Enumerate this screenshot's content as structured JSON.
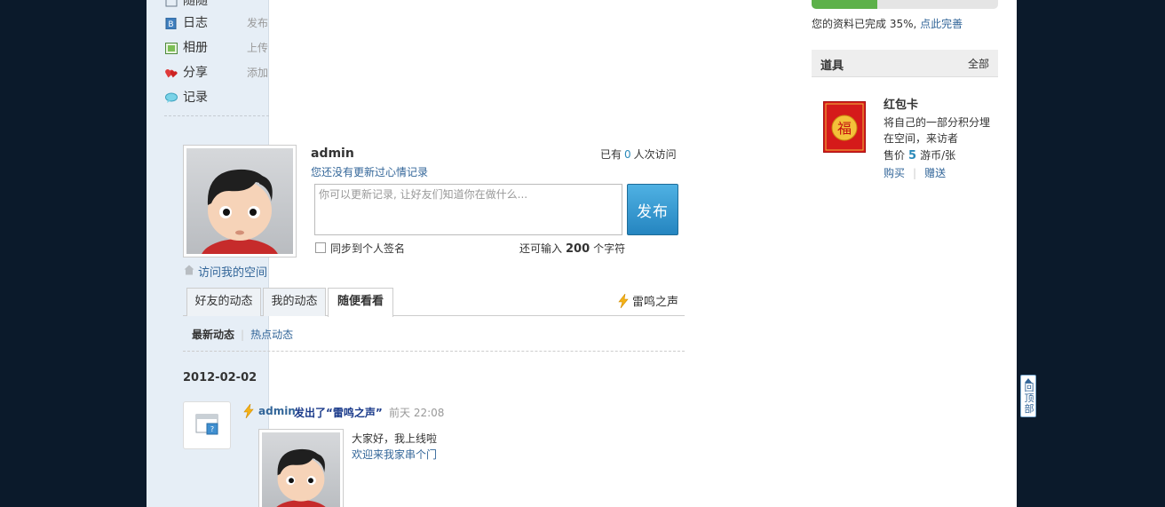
{
  "sidebar": {
    "items": [
      {
        "label": "随随",
        "action": "",
        "icon": "partial-icon"
      },
      {
        "label": "日志",
        "action": "发布",
        "icon": "blog-icon"
      },
      {
        "label": "相册",
        "action": "上传",
        "icon": "album-icon"
      },
      {
        "label": "分享",
        "action": "添加",
        "icon": "share-heart-icon"
      },
      {
        "label": "记录",
        "action": "",
        "icon": "speech-bubble-icon"
      }
    ]
  },
  "profile": {
    "username": "admin",
    "visit_prefix": "已有",
    "visit_count": "0",
    "visit_suffix": "人次访问",
    "no_mood": "您还没有更新过心情记录",
    "visit_space": "访问我的空间"
  },
  "composer": {
    "placeholder": "你可以更新记录, 让好友们知道你在做什么...",
    "publish_label": "发布",
    "sync_label": "同步到个人签名",
    "remaining_prefix": "还可输入",
    "remaining_count": "200",
    "remaining_suffix": "个字符"
  },
  "tabs": [
    {
      "label": "好友的动态"
    },
    {
      "label": "我的动态"
    },
    {
      "label": "随便看看"
    }
  ],
  "thunder_label": "雷鸣之声",
  "subtabs": {
    "latest": "最新动态",
    "hot": "热点动态"
  },
  "feed": {
    "date": "2012-02-02",
    "who": "admin",
    "action": "发出了“雷鸣之声”",
    "when": "前天 22:08",
    "text1": "大家好，我上线啦",
    "text2": "欢迎来我家串个门"
  },
  "right": {
    "progress_percent": 35,
    "complete_text": "您的资料已完成 35%,",
    "complete_link": "点此完善",
    "props_title": "道具",
    "props_all": "全部",
    "card": {
      "name": "红包卡",
      "desc": "将自己的一部分积分埋在空间，来访者",
      "price_prefix": "售价",
      "price": "5",
      "price_suffix": "游币/张",
      "buy": "购买",
      "gift": "赠送",
      "glyph": "福"
    }
  },
  "back_to_top": "回顶部",
  "colors": {
    "page_bg": "#0b1a2b",
    "sidebar_bg": "#e6eef6",
    "link": "#336699",
    "publish_button": "#2585c0",
    "progress_fill": "#5db14a",
    "red_card": "#d51a1a"
  }
}
